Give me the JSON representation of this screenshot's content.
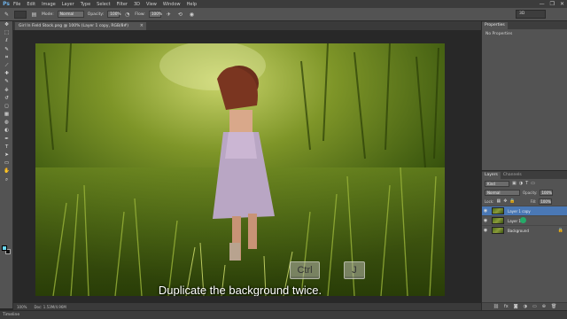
{
  "app": {
    "logo": "Ps",
    "menu": [
      "File",
      "Edit",
      "Image",
      "Layer",
      "Type",
      "Select",
      "Filter",
      "3D",
      "View",
      "Window",
      "Help"
    ],
    "window_controls": [
      "—",
      "❐",
      "✕"
    ]
  },
  "options_bar": {
    "mode_label": "Mode:",
    "mode_value": "Normal",
    "opacity_label": "Opacity:",
    "opacity_value": "100%",
    "flow_label": "Flow:",
    "flow_value": "100%",
    "workspace": "3D"
  },
  "tools": [
    "move",
    "marquee",
    "lasso",
    "quick-select",
    "crop",
    "eyedropper",
    "healing",
    "brush",
    "clone-stamp",
    "history-brush",
    "eraser",
    "gradient",
    "blur",
    "dodge",
    "pen",
    "type",
    "path-select",
    "rectangle",
    "hand",
    "zoom"
  ],
  "tool_glyphs": [
    "✥",
    "⬚",
    "ℓ",
    "✎",
    "⌗",
    "⟋",
    "✚",
    "✎",
    "⎈",
    "↺",
    "◻",
    "▦",
    "◍",
    "◐",
    "✒",
    "T",
    "➤",
    "▭",
    "✋",
    "⌕"
  ],
  "document": {
    "tab_title": "Girl In Field Stock.png @ 100% (Layer 1 copy, RGB/8#)",
    "tab_close": "×"
  },
  "video_overlay": {
    "keys": [
      "Ctrl",
      "J"
    ],
    "caption": "Duplicate the background twice."
  },
  "status": {
    "zoom": "100%",
    "doc_info": "Doc: 1.53M/4.96M"
  },
  "timeline": {
    "label": "Timeline"
  },
  "properties_panel": {
    "tab": "Properties",
    "message": "No Properties"
  },
  "layers_panel": {
    "tabs": [
      "Layers",
      "Channels"
    ],
    "filter_kind": "Kind",
    "blend_mode": "Normal",
    "opacity_label": "Opacity:",
    "opacity_value": "100%",
    "lock_label": "Lock:",
    "fill_label": "Fill:",
    "fill_value": "100%",
    "layers": [
      {
        "name": "Layer 1 copy",
        "selected": true
      },
      {
        "name": "Layer 1",
        "selected": false
      },
      {
        "name": "Background",
        "selected": false
      }
    ],
    "footer_icons": [
      "link",
      "fx",
      "mask",
      "adjust",
      "folder",
      "new",
      "trash"
    ],
    "footer_glyphs": [
      "⛓",
      "fx",
      "◙",
      "◑",
      "▭",
      "⊕",
      "🗑"
    ]
  },
  "colors": {
    "foreground": "#6ad6f0",
    "background": "#111111",
    "selected_layer": "#4a78b5"
  }
}
